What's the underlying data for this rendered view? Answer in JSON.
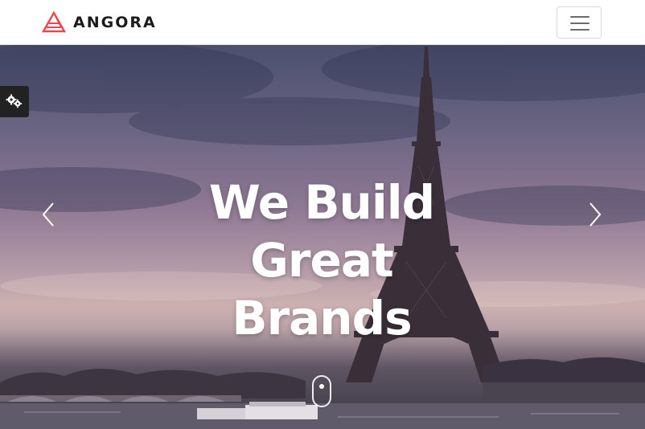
{
  "header": {
    "brand_name": "ANGORA",
    "logo_icon": "angora-triangle-logo-icon",
    "brand_color": "#e8474c",
    "menu_icon": "hamburger-menu-icon"
  },
  "hero": {
    "title_lines": [
      "We Build",
      "Great",
      "Brands"
    ],
    "background": "eiffel-tower-dusk-photo",
    "prev_icon": "chevron-left-icon",
    "next_icon": "chevron-right-icon",
    "scroll_icon": "mouse-scroll-icon"
  },
  "settings": {
    "icon": "gears-icon"
  }
}
